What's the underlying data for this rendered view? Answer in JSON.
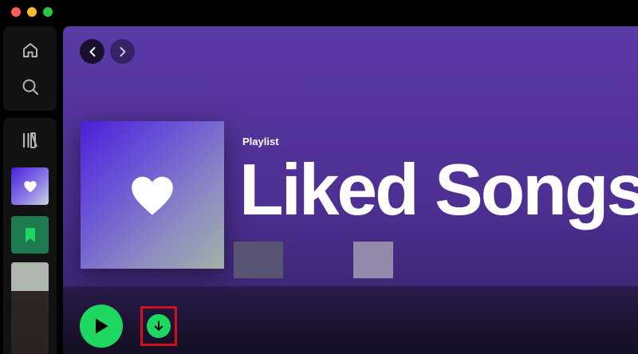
{
  "window": {
    "controls": [
      "close",
      "minimize",
      "zoom"
    ]
  },
  "nav": {
    "icons": [
      "home-icon",
      "search-icon"
    ]
  },
  "library": {
    "icons": [
      "library-icon",
      "heart-icon",
      "bookmark-icon"
    ]
  },
  "main": {
    "navigation_icons": [
      "chevron-left-icon",
      "chevron-right-icon"
    ],
    "header": {
      "type_label": "Playlist",
      "title": "Liked Songs"
    },
    "actions": {
      "icons": [
        "play-icon",
        "download-icon"
      ]
    }
  },
  "colors": {
    "accent": "#1ed760",
    "highlight": "#d0101c",
    "header_purple": "#5b3aa6"
  }
}
